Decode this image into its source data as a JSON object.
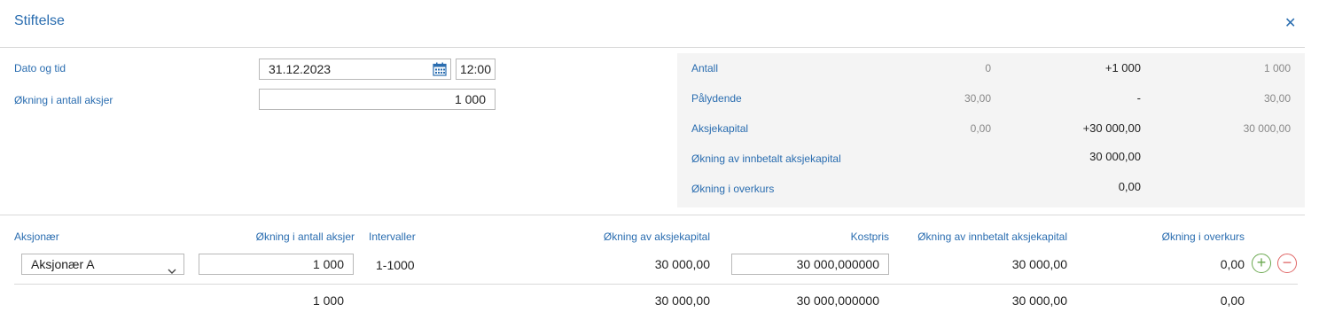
{
  "dialog": {
    "title": "Stiftelse"
  },
  "form": {
    "date_label": "Dato og tid",
    "date_value": "31.12.2023",
    "time_value": "12:00",
    "increase_label": "Økning i antall aksjer",
    "increase_value": "1 000"
  },
  "summary": {
    "rows": [
      {
        "label": "Antall",
        "before": "0",
        "change": "+1 000",
        "after": "1 000"
      },
      {
        "label": "Pålydende",
        "before": "30,00",
        "change": "-",
        "after": "30,00"
      },
      {
        "label": "Aksjekapital",
        "before": "0,00",
        "change": "+30 000,00",
        "after": "30 000,00"
      },
      {
        "label": "Økning av innbetalt aksjekapital",
        "before": "",
        "change": "30 000,00",
        "after": ""
      },
      {
        "label": "Økning i overkurs",
        "before": "",
        "change": "0,00",
        "after": ""
      }
    ]
  },
  "table": {
    "headers": {
      "shareholder": "Aksjonær",
      "increase": "Økning i antall aksjer",
      "intervals": "Intervaller",
      "capital_increase": "Økning av aksjekapital",
      "cost": "Kostpris",
      "paid_increase": "Økning av innbetalt aksjekapital",
      "premium": "Økning i overkurs"
    },
    "row": {
      "shareholder": "Aksjonær A",
      "increase": "1 000",
      "intervals": "1-1000",
      "capital_increase": "30 000,00",
      "cost": "30 000,000000",
      "paid_increase": "30 000,00",
      "premium": "0,00"
    },
    "totals": {
      "increase": "1 000",
      "capital_increase": "30 000,00",
      "cost": "30 000,000000",
      "paid_increase": "30 000,00",
      "premium": "0,00"
    }
  },
  "colors": {
    "accent": "#2a6db0",
    "add": "#6aa84f",
    "remove": "#e06666"
  }
}
